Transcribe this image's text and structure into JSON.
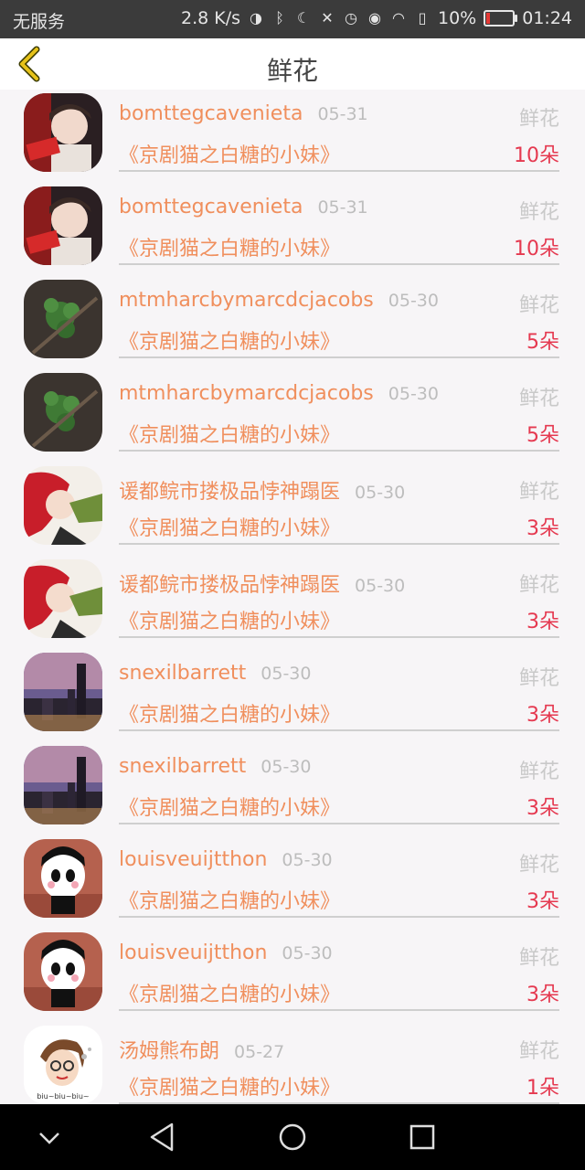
{
  "status_bar": {
    "carrier": "无服务",
    "speed": "2.8 K/s",
    "battery": "10%",
    "time": "01:24"
  },
  "header": {
    "title": "鲜花"
  },
  "rows": [
    {
      "name": "bomttegcavenieta",
      "date": "05-31",
      "gift": "鲜花",
      "book": "《京剧猫之白糖的小妹》",
      "count": "10朵",
      "avatar": "avatar-boy-photo"
    },
    {
      "name": "bomttegcavenieta",
      "date": "05-31",
      "gift": "鲜花",
      "book": "《京剧猫之白糖的小妹》",
      "count": "10朵",
      "avatar": "avatar-boy-photo"
    },
    {
      "name": "mtmharcbymarcdcjacobs",
      "date": "05-30",
      "gift": "鲜花",
      "book": "《京剧猫之白糖的小妹》",
      "count": "5朵",
      "avatar": "avatar-plant"
    },
    {
      "name": "mtmharcbymarcdcjacobs",
      "date": "05-30",
      "gift": "鲜花",
      "book": "《京剧猫之白糖的小妹》",
      "count": "5朵",
      "avatar": "avatar-plant"
    },
    {
      "name": "谖都鲩市搂极品悖神蹋医",
      "date": "05-30",
      "gift": "鲜花",
      "book": "《京剧猫之白糖的小妹》",
      "count": "3朵",
      "avatar": "avatar-red-hair"
    },
    {
      "name": "谖都鲩市搂极品悖神蹋医",
      "date": "05-30",
      "gift": "鲜花",
      "book": "《京剧猫之白糖的小妹》",
      "count": "3朵",
      "avatar": "avatar-red-hair"
    },
    {
      "name": "snexilbarrett",
      "date": "05-30",
      "gift": "鲜花",
      "book": "《京剧猫之白糖的小妹》",
      "count": "3朵",
      "avatar": "avatar-city"
    },
    {
      "name": "snexilbarrett",
      "date": "05-30",
      "gift": "鲜花",
      "book": "《京剧猫之白糖的小妹》",
      "count": "3朵",
      "avatar": "avatar-city"
    },
    {
      "name": "louisveuijtthon",
      "date": "05-30",
      "gift": "鲜花",
      "book": "《京剧猫之白糖的小妹》",
      "count": "3朵",
      "avatar": "avatar-panda"
    },
    {
      "name": "louisveuijtthon",
      "date": "05-30",
      "gift": "鲜花",
      "book": "《京剧猫之白糖的小妹》",
      "count": "3朵",
      "avatar": "avatar-panda"
    },
    {
      "name": "汤姆熊布朗",
      "date": "05-27",
      "gift": "鲜花",
      "book": "《京剧猫之白糖的小妹》",
      "count": "1朵",
      "avatar": "avatar-cartoon-girl"
    }
  ],
  "avatar_text": "biu~biu~biu~",
  "colors": {
    "accent_orange": "#f08f5d",
    "count_red": "#e53950",
    "back_arrow": "#e6c21a"
  }
}
